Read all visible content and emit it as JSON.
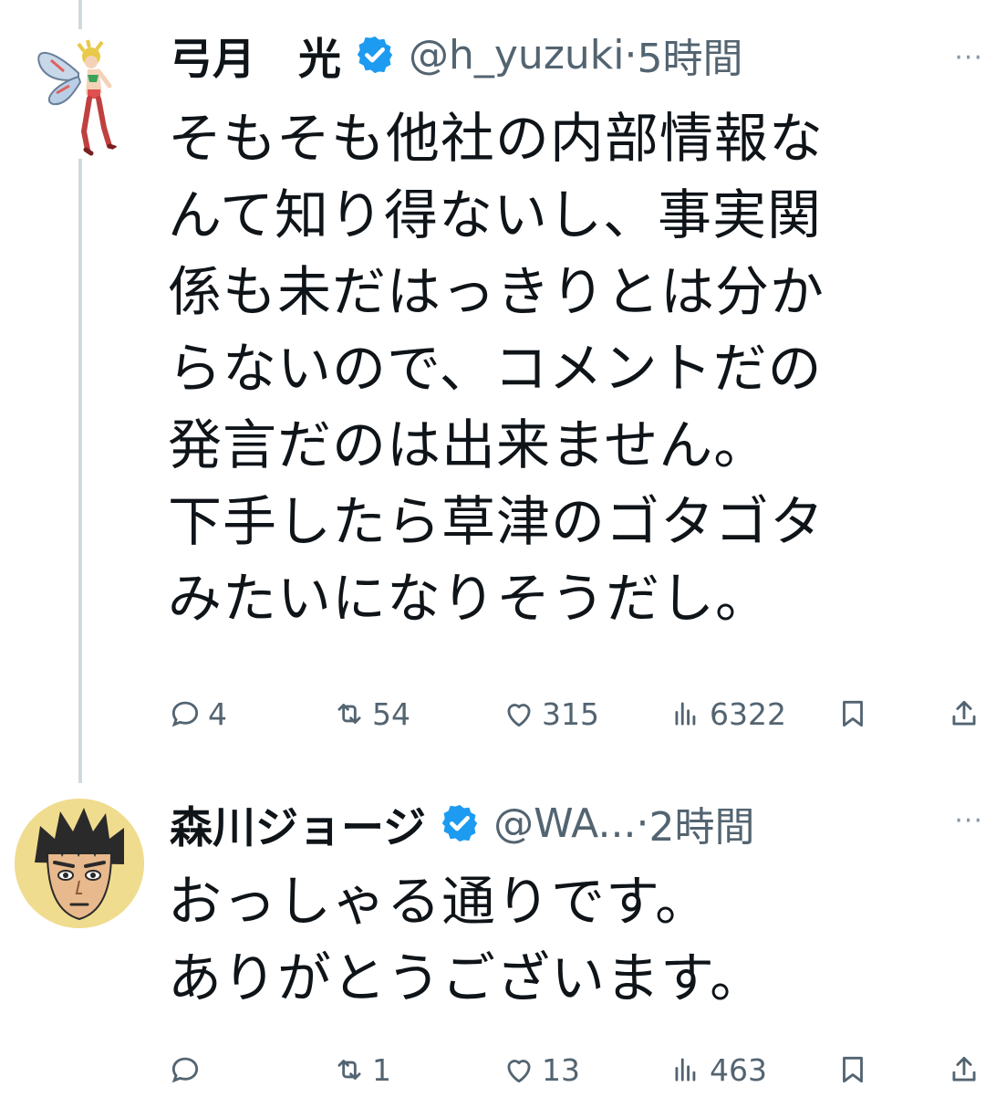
{
  "tweets": [
    {
      "name": "弓月　光",
      "handle": "@h_yuzuki",
      "separator": "·",
      "time": "5時間",
      "more": "···",
      "text_lines": [
        "そもそも他社の内部情報な",
        "んて知り得ないし、事実関",
        "係も未だはっきりとは分か",
        "らないので、コメントだの",
        "発言だのは出来ません。",
        "下手したら草津のゴタゴタ",
        "みたいになりそうだし。"
      ],
      "stats": {
        "replies": "4",
        "reposts": "54",
        "likes": "315",
        "views": "6322"
      }
    },
    {
      "name": "森川ジョージ",
      "handle": "@WA...",
      "separator": "·",
      "time": "2時間",
      "more": "···",
      "text_lines": [
        "おっしゃる通りです。",
        "ありがとうございます。"
      ],
      "stats": {
        "replies": "",
        "reposts": "1",
        "likes": "13",
        "views": "463"
      }
    }
  ],
  "colors": {
    "verified": "#1d9bf0",
    "muted": "#536471",
    "text": "#0f1419",
    "thread_line": "#cfd9de"
  },
  "icons": [
    "fairy-avatar",
    "verified-badge-icon",
    "reply-icon",
    "repost-icon",
    "like-icon",
    "views-icon",
    "bookmark-icon",
    "share-icon",
    "manga-boy-avatar"
  ]
}
